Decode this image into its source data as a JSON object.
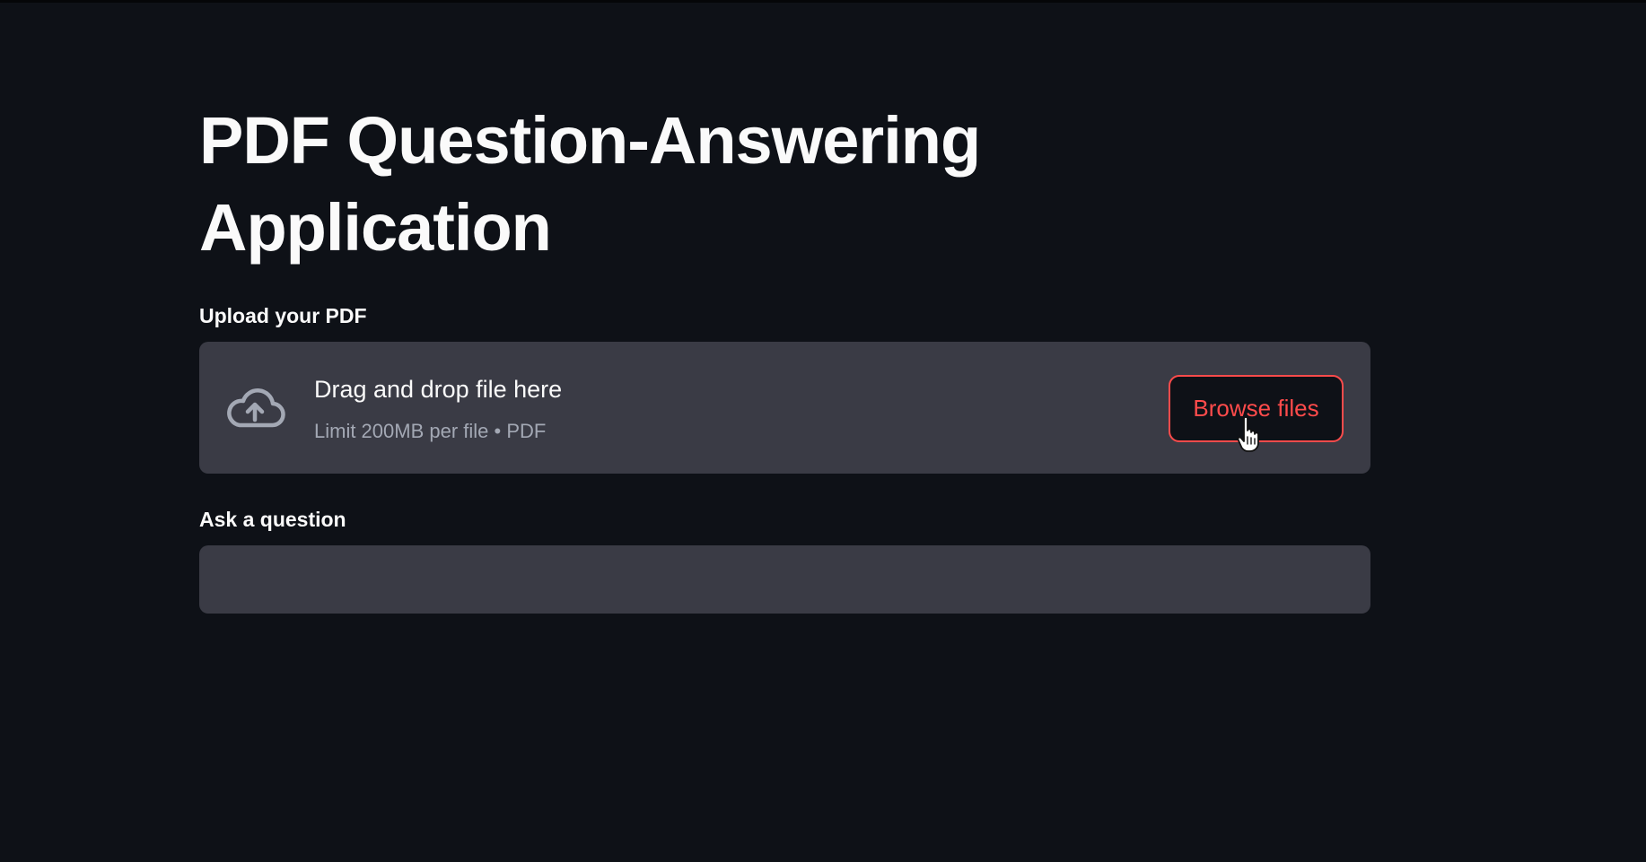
{
  "page": {
    "title": "PDF Question-Answering Application"
  },
  "uploader": {
    "label": "Upload your PDF",
    "drop_title": "Drag and drop file here",
    "drop_hint": "Limit 200MB per file • PDF",
    "browse_label": "Browse files",
    "icon": "cloud-upload-icon"
  },
  "question": {
    "label": "Ask a question",
    "value": "",
    "placeholder": ""
  },
  "colors": {
    "background": "#0e1117",
    "widget_background": "#3a3b45",
    "accent": "#ff4b4b",
    "text": "#fafafa",
    "muted_text": "#a3a8b4"
  }
}
